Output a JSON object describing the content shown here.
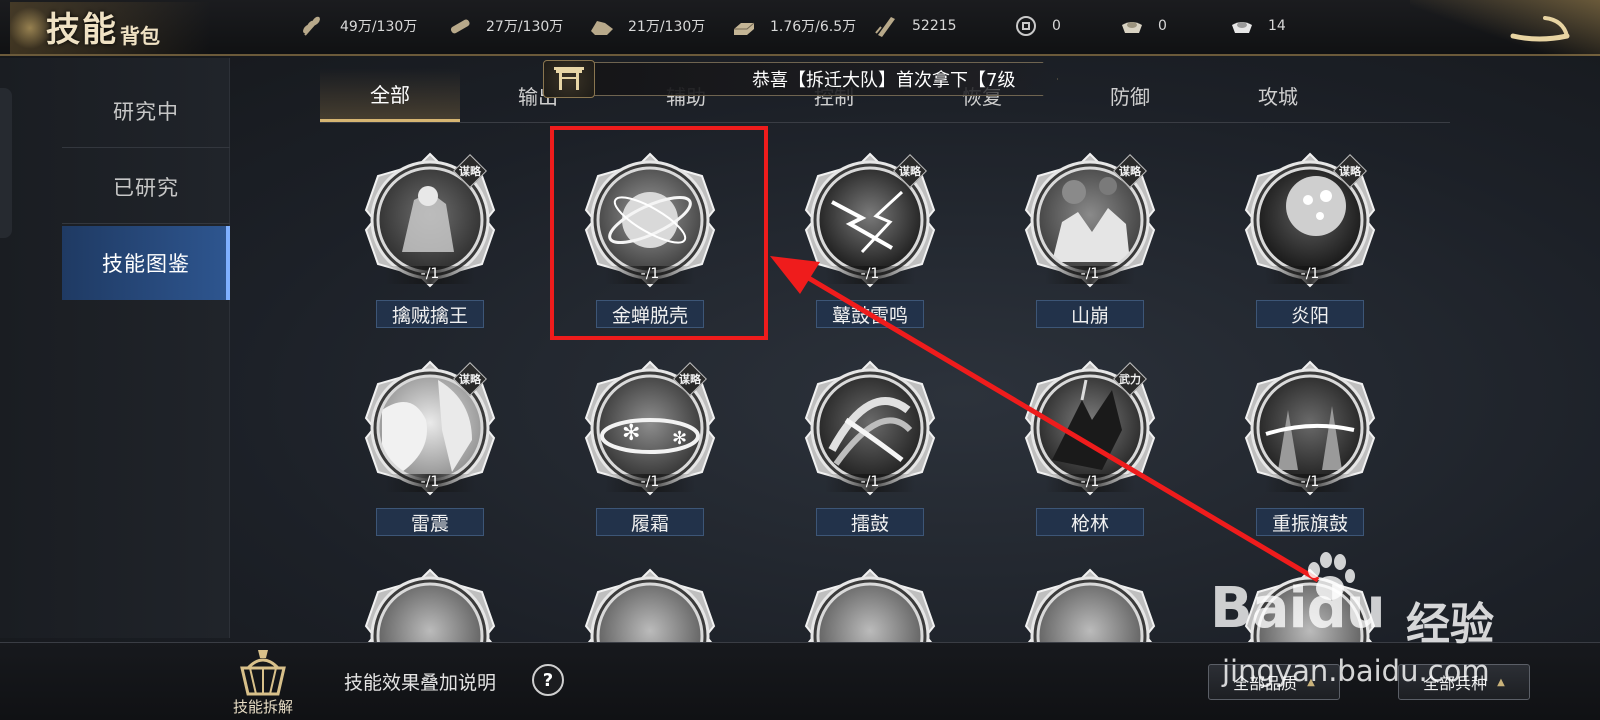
{
  "header": {
    "title_main": "技能",
    "title_sub": "背包",
    "resources": [
      {
        "icon": "grain-icon",
        "value": "49万/130万"
      },
      {
        "icon": "wood-icon",
        "value": "27万/130万"
      },
      {
        "icon": "stone-icon",
        "value": "21万/130万"
      },
      {
        "icon": "iron-icon",
        "value": "1.76万/6.5万"
      },
      {
        "icon": "decree-icon",
        "value": "52215"
      },
      {
        "icon": "copper-coin-icon",
        "value": "0"
      },
      {
        "icon": "gold-ingot-icon",
        "value": "0"
      },
      {
        "icon": "silver-ingot-icon",
        "value": "14"
      }
    ]
  },
  "sidebar": {
    "items": [
      {
        "label": "研究中"
      },
      {
        "label": "已研究"
      },
      {
        "label": "技能图鉴"
      }
    ]
  },
  "tabs": [
    {
      "label": "全部"
    },
    {
      "label": "输出"
    },
    {
      "label": "辅助"
    },
    {
      "label": "控制"
    },
    {
      "label": "恢复"
    },
    {
      "label": "防御"
    },
    {
      "label": "攻城"
    }
  ],
  "banner": {
    "text": "恭喜【拆迁大队】首次拿下【7级"
  },
  "skills": [
    {
      "name": "擒贼擒王",
      "count": "-/1",
      "tag": "谋略"
    },
    {
      "name": "金蝉脱壳",
      "count": "-/1",
      "tag": ""
    },
    {
      "name": "鼙鼓雷鸣",
      "count": "-/1",
      "tag": "谋略"
    },
    {
      "name": "山崩",
      "count": "-/1",
      "tag": "谋略"
    },
    {
      "name": "炎阳",
      "count": "-/1",
      "tag": "谋略"
    },
    {
      "name": "雷震",
      "count": "-/1",
      "tag": "谋略"
    },
    {
      "name": "履霜",
      "count": "-/1",
      "tag": "谋略"
    },
    {
      "name": "擂鼓",
      "count": "-/1",
      "tag": ""
    },
    {
      "name": "枪林",
      "count": "-/1",
      "tag": "武力"
    },
    {
      "name": "重振旗鼓",
      "count": "-/1",
      "tag": ""
    }
  ],
  "bottom": {
    "disassemble_label": "技能拆解",
    "stack_help": "技能效果叠加说明",
    "help_symbol": "?",
    "filter_quality": "全部品质",
    "filter_troop": "全部兵种"
  },
  "watermark": {
    "logo": "Baidu",
    "cn": "经验",
    "url": "jingyan.baidu.com"
  },
  "colors": {
    "accent_gold": "#d6b572",
    "active_blue": "#2e5690",
    "annotation_red": "#ef1c1c"
  }
}
